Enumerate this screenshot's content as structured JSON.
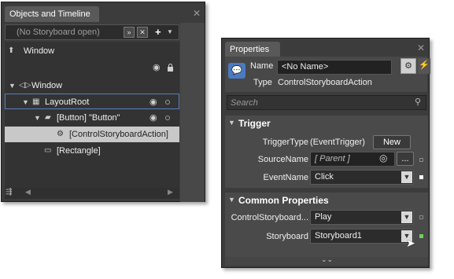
{
  "objects_panel": {
    "title": "Objects and Timeline",
    "storyboard": "(No Storyboard open)",
    "root_label": "Window",
    "tree": [
      {
        "label": "Window"
      },
      {
        "label": "LayoutRoot"
      },
      {
        "label": "[Button] \"Button\""
      },
      {
        "label": "[ControlStoryboardAction]"
      },
      {
        "label": "[Rectangle]"
      }
    ]
  },
  "properties_panel": {
    "title": "Properties",
    "name_label": "Name",
    "name_value": "<No Name>",
    "type_label": "Type",
    "type_value": "ControlStoryboardAction",
    "search_placeholder": "Search",
    "trigger": {
      "title": "Trigger",
      "trigger_type_label": "TriggerType",
      "trigger_type_value": "(EventTrigger)",
      "new_button": "New",
      "source_name_label": "SourceName",
      "source_name_value": "[ Parent ]",
      "browse_button": "...",
      "event_name_label": "EventName",
      "event_name_value": "Click"
    },
    "common": {
      "title": "Common Properties",
      "csa_label": "ControlStoryboard...",
      "csa_value": "Play",
      "storyboard_label": "Storyboard",
      "storyboard_value": "Storyboard1"
    }
  },
  "colors": {
    "panel": "#3c3c3c",
    "selection": "#4d4d4d",
    "highlight_border": "#5a7fc0"
  }
}
